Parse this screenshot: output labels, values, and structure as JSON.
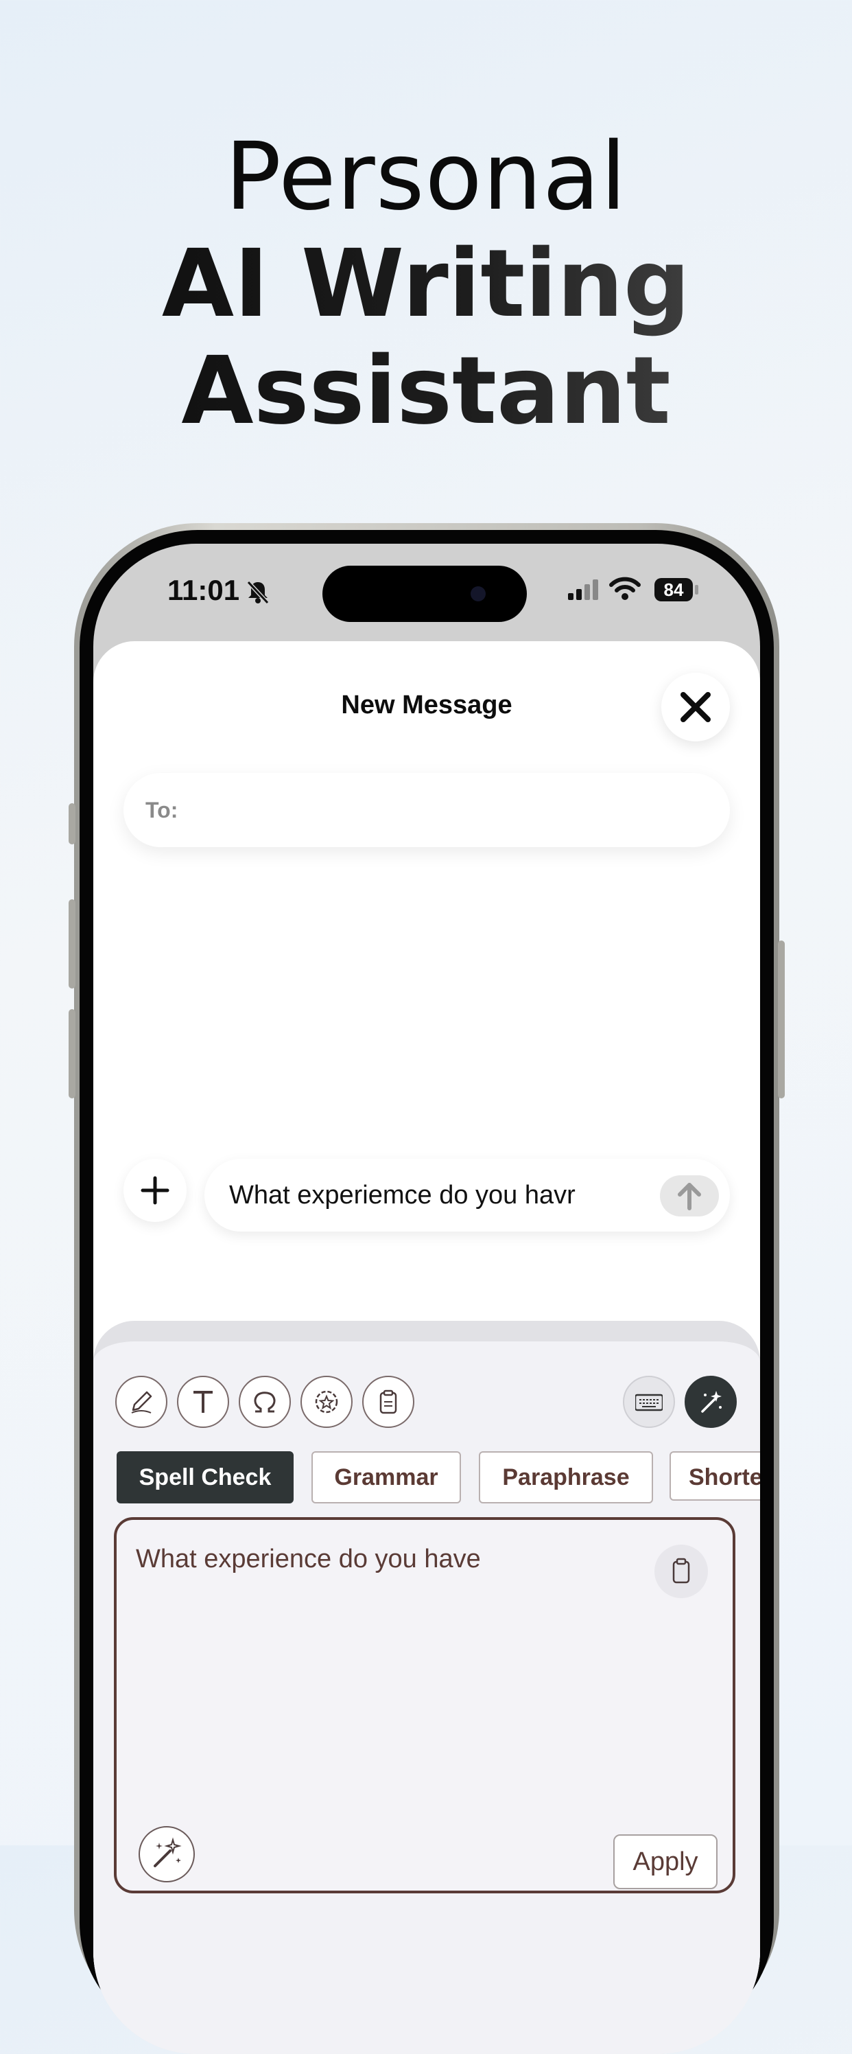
{
  "headline": {
    "line1": "Personal",
    "line2": "AI Writing",
    "line3": "Assistant"
  },
  "status_bar": {
    "time": "11:01",
    "battery": "84",
    "icons": [
      "bell-slash-icon",
      "cellular-signal-icon",
      "wifi-icon",
      "battery-icon"
    ]
  },
  "compose": {
    "title": "New Message",
    "to_label": "To:",
    "message_text": "What experiemce do you havr"
  },
  "keyboard": {
    "tools": [
      "pencil-icon",
      "text-format-icon",
      "omega-symbol-icon",
      "star-badge-icon",
      "clipboard-icon",
      "keyboard-icon",
      "magic-wand-icon"
    ],
    "modes": [
      {
        "label": "Spell Check",
        "active": true
      },
      {
        "label": "Grammar",
        "active": false
      },
      {
        "label": "Paraphrase",
        "active": false
      },
      {
        "label": "Shorte",
        "active": false
      }
    ],
    "output_text": "What experience do you have",
    "apply_label": "Apply"
  },
  "colors": {
    "accent_dark": "#2f3536",
    "brown_text": "#5a3b36"
  }
}
